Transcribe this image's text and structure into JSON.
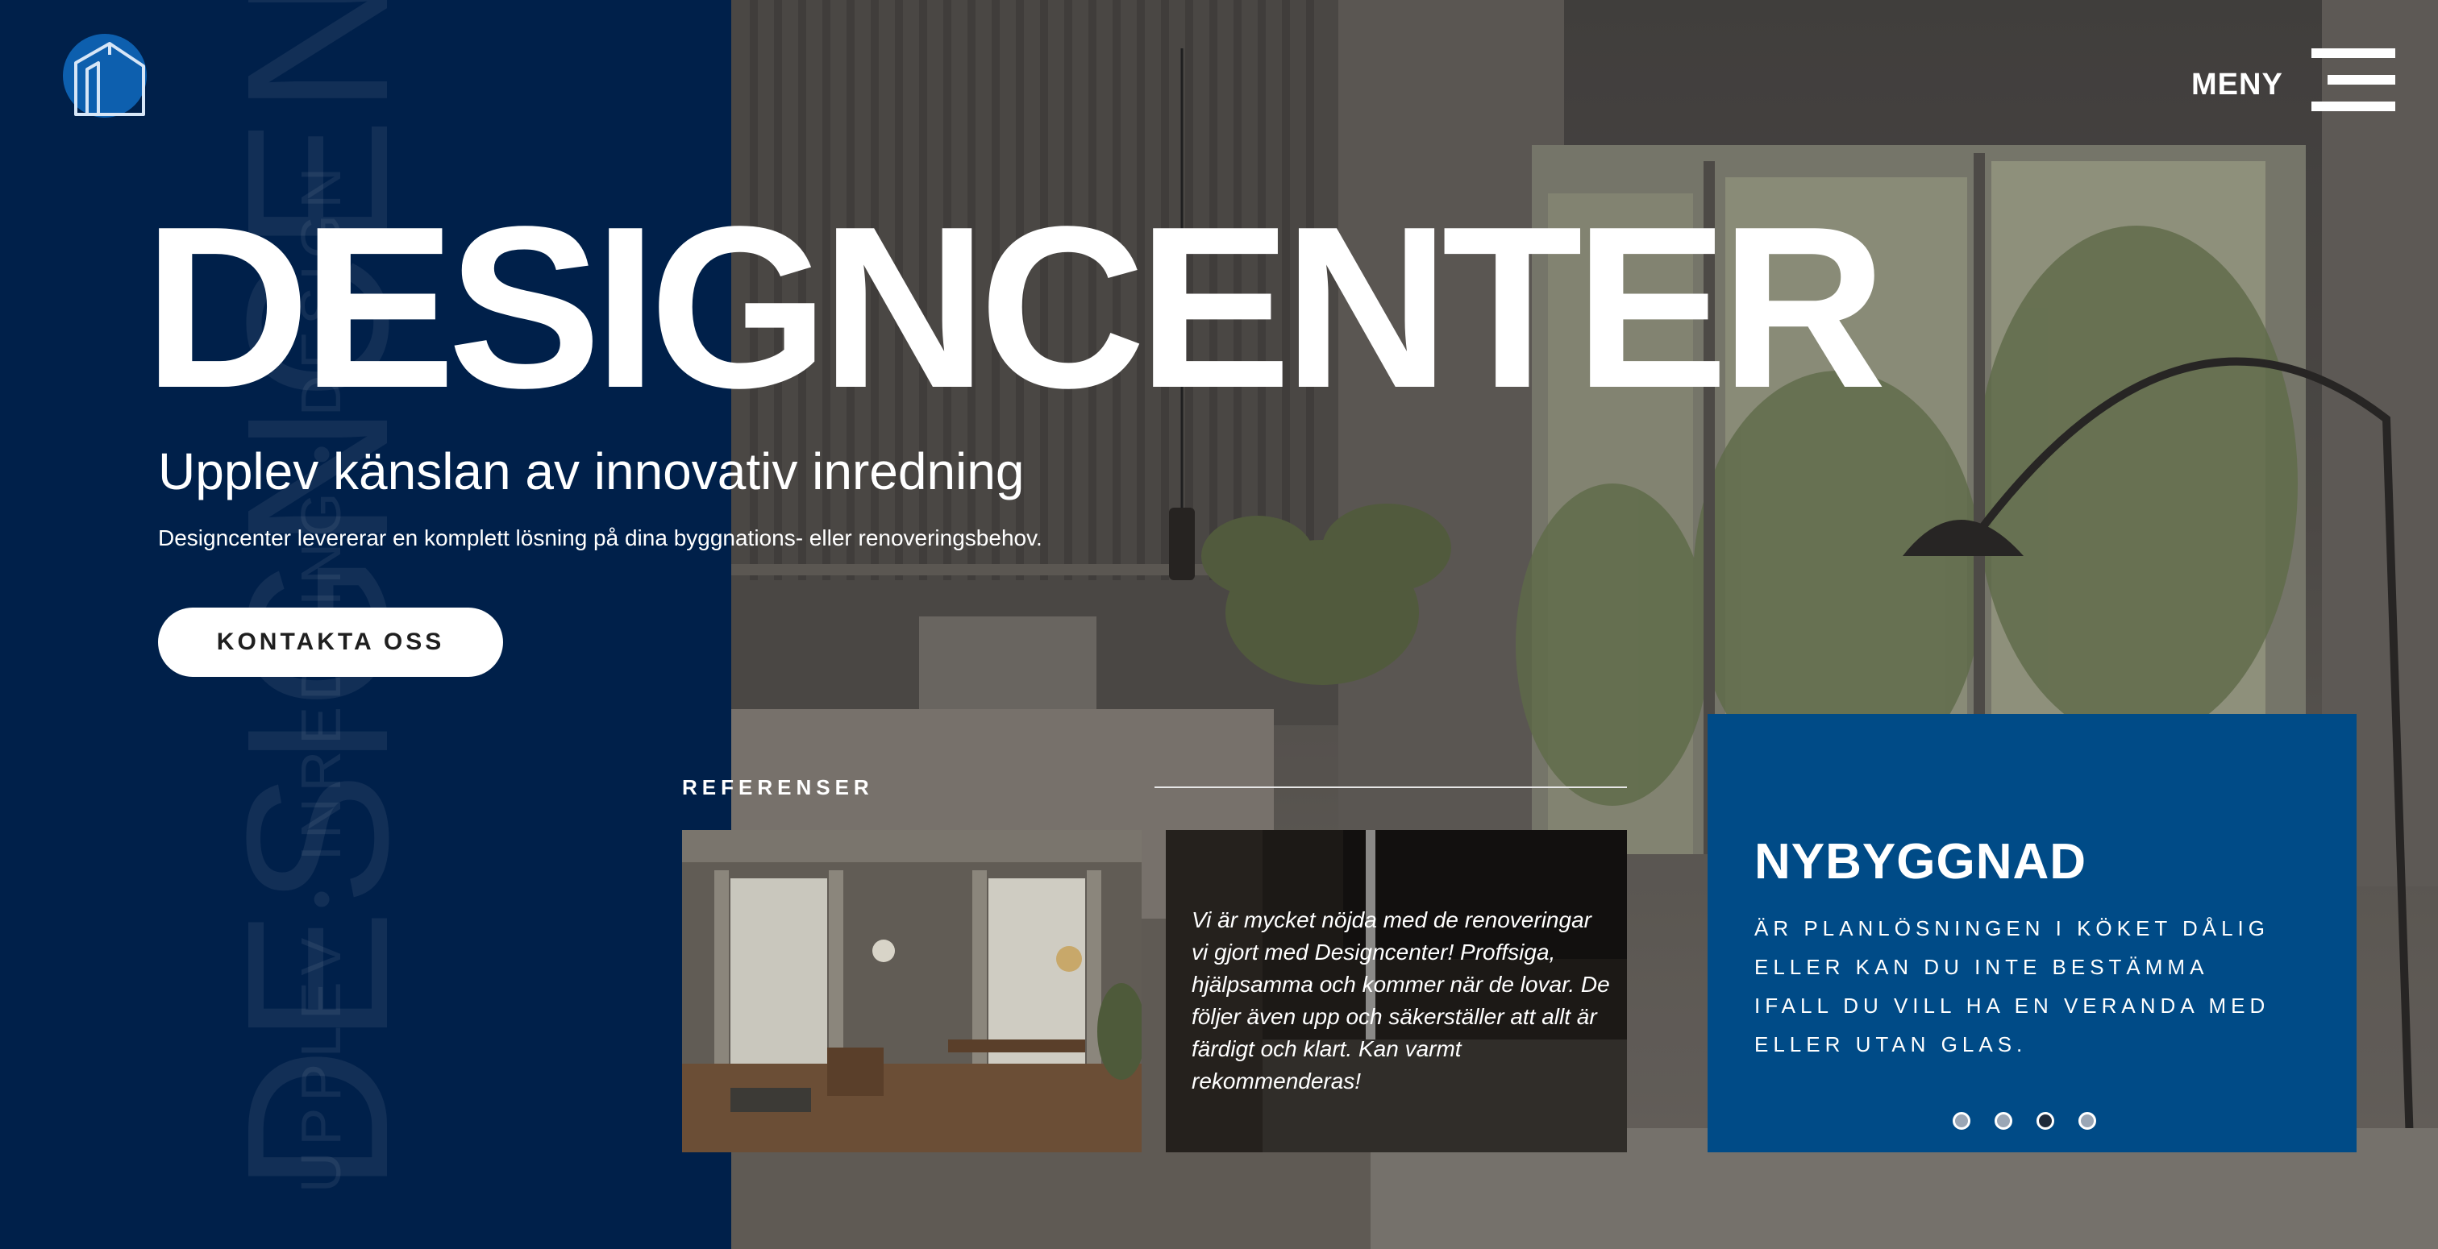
{
  "brand": {
    "logo_icon": "house-logo-icon",
    "vertical_word": "DESIGNCENTER",
    "vertical_sub": "UPPLEV • INREDNING • DESIGN"
  },
  "header": {
    "menu_label": "MENY",
    "menu_icon": "hamburger-menu-icon"
  },
  "hero": {
    "title": "DESIGNCENTER",
    "subtitle": "Upplev känslan av innovativ inredning",
    "description": "Designcenter levererar en komplett lösning på dina byggnations- eller renoveringsbehov.",
    "cta_label": "KONTAKTA OSS"
  },
  "references": {
    "label": "REFERENSER",
    "quote": "Vi är mycket nöjda med de renoveringar vi gjort med Designcenter! Proffsiga, hjälpsamma och kommer när de lovar. De följer även upp och säkerställer att allt är färdigt och klart. Kan varmt rekommenderas!"
  },
  "info_card": {
    "title": "NYBYGGNAD",
    "text": "Är planlösningen i köket dålig eller kan du inte bestämma ifall du vill ha en veranda med eller utan glas.",
    "slides": 4,
    "active_slide": 3
  },
  "colors": {
    "navy": "#00204a",
    "card_blue": "#004b87",
    "white": "#ffffff"
  }
}
